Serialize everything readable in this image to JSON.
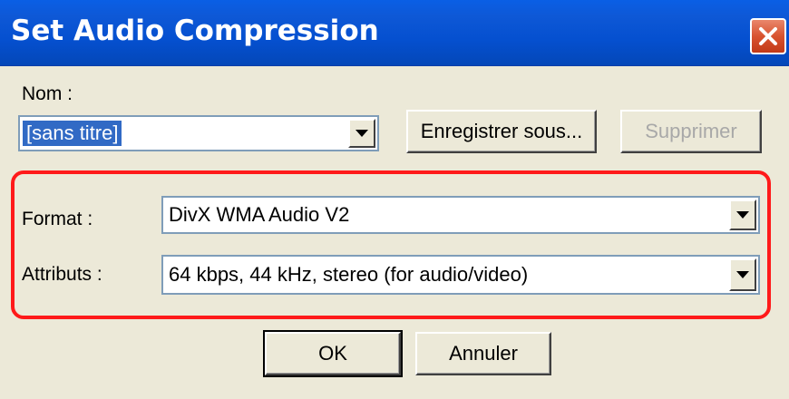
{
  "window": {
    "title": "Set Audio Compression",
    "close_icon": "close-icon"
  },
  "name_section": {
    "label": "Nom :",
    "value": "[sans titre]",
    "save_as_label": "Enregistrer sous...",
    "delete_label": "Supprimer"
  },
  "format_section": {
    "format_label": "Format :",
    "format_value": "DivX WMA Audio V2",
    "attributes_label": "Attributs :",
    "attributes_value": "64 kbps, 44 kHz, stereo (for audio/video)",
    "highlight_color": "#FF1A1A"
  },
  "footer": {
    "ok_label": "OK",
    "cancel_label": "Annuler"
  },
  "colors": {
    "titlebar": "#0550D0",
    "dialog_bg": "#ECE9D8",
    "selection": "#316AC5"
  }
}
